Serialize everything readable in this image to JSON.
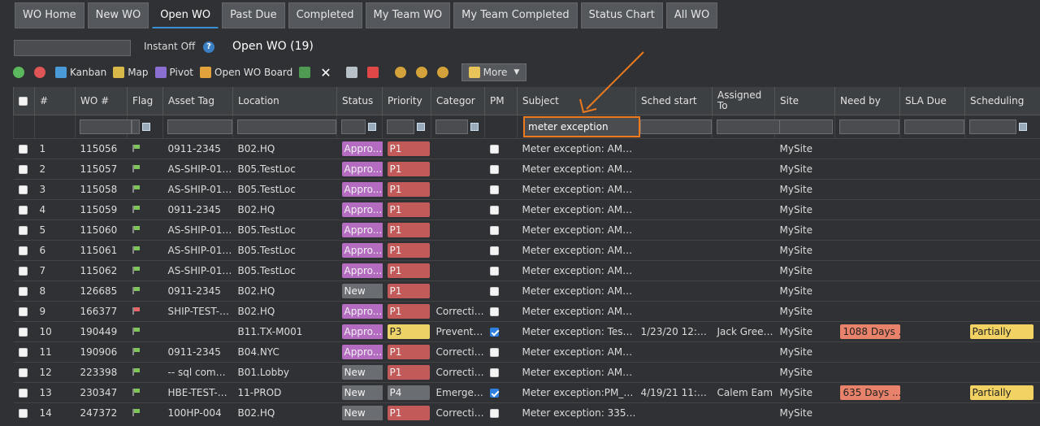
{
  "tabs": [
    {
      "label": "WO Home",
      "active": false
    },
    {
      "label": "New WO",
      "active": false
    },
    {
      "label": "Open WO",
      "active": true
    },
    {
      "label": "Past Due",
      "active": false
    },
    {
      "label": "Completed",
      "active": false
    },
    {
      "label": "My Team WO",
      "active": false
    },
    {
      "label": "My Team Completed",
      "active": false
    },
    {
      "label": "Status Chart",
      "active": false
    },
    {
      "label": "All WO",
      "active": false
    }
  ],
  "header": {
    "instant": "Instant Off",
    "help": "?",
    "title": "Open WO (19)"
  },
  "toolbar": {
    "kanban": "Kanban",
    "map": "Map",
    "pivot": "Pivot",
    "board": "Open WO Board",
    "more": "More"
  },
  "colors": {
    "approved": "#b36cc0",
    "new": "#6a6d71",
    "p1": "#c25a5a",
    "p3": "#ecd166",
    "p4": "#6a6d71",
    "flag_green": "#7fc65a",
    "flag_red": "#e56767",
    "accent": "#3a8fd1",
    "annotation": "#ee7a1e"
  },
  "columns": [
    "#",
    "WO #",
    "Flag",
    "Asset Tag",
    "Location",
    "Status",
    "Priority",
    "Categor",
    "PM",
    "Subject",
    "Sched start",
    "Assigned To",
    "Site",
    "Need by",
    "SLA Due",
    "Scheduling"
  ],
  "filter": {
    "subject": "meter exception"
  },
  "rows": [
    {
      "n": "1",
      "wo": "115056",
      "flag": "green",
      "asset": "0911-2345",
      "loc": "B02.HQ",
      "status": "Appro...",
      "st": "approved",
      "pri": "P1",
      "cat": "",
      "pm": false,
      "subject": "Meter exception: AMP-...",
      "sched": "",
      "assigned": "",
      "site": "MySite",
      "need": "",
      "sla": "",
      "scheduling": ""
    },
    {
      "n": "2",
      "wo": "115057",
      "flag": "green",
      "asset": "AS-SHIP-01_...",
      "loc": "B05.TestLoc",
      "status": "Appro...",
      "st": "approved",
      "pri": "P1",
      "cat": "",
      "pm": false,
      "subject": "Meter exception: AMP-...",
      "sched": "",
      "assigned": "",
      "site": "MySite",
      "need": "",
      "sla": "",
      "scheduling": ""
    },
    {
      "n": "3",
      "wo": "115058",
      "flag": "green",
      "asset": "AS-SHIP-01_...",
      "loc": "B05.TestLoc",
      "status": "Appro...",
      "st": "approved",
      "pri": "P1",
      "cat": "",
      "pm": false,
      "subject": "Meter exception: AMP-...",
      "sched": "",
      "assigned": "",
      "site": "MySite",
      "need": "",
      "sla": "",
      "scheduling": ""
    },
    {
      "n": "4",
      "wo": "115059",
      "flag": "green",
      "asset": "0911-2345",
      "loc": "B02.HQ",
      "status": "Appro...",
      "st": "approved",
      "pri": "P1",
      "cat": "",
      "pm": false,
      "subject": "Meter exception: AMP-...",
      "sched": "",
      "assigned": "",
      "site": "MySite",
      "need": "",
      "sla": "",
      "scheduling": ""
    },
    {
      "n": "5",
      "wo": "115060",
      "flag": "green",
      "asset": "AS-SHIP-01_...",
      "loc": "B05.TestLoc",
      "status": "Appro...",
      "st": "approved",
      "pri": "P1",
      "cat": "",
      "pm": false,
      "subject": "Meter exception: AMP-...",
      "sched": "",
      "assigned": "",
      "site": "MySite",
      "need": "",
      "sla": "",
      "scheduling": ""
    },
    {
      "n": "6",
      "wo": "115061",
      "flag": "green",
      "asset": "AS-SHIP-01_...",
      "loc": "B05.TestLoc",
      "status": "Appro...",
      "st": "approved",
      "pri": "P1",
      "cat": "",
      "pm": false,
      "subject": "Meter exception: AMP-...",
      "sched": "",
      "assigned": "",
      "site": "MySite",
      "need": "",
      "sla": "",
      "scheduling": ""
    },
    {
      "n": "7",
      "wo": "115062",
      "flag": "green",
      "asset": "AS-SHIP-01_...",
      "loc": "B05.TestLoc",
      "status": "Appro...",
      "st": "approved",
      "pri": "P1",
      "cat": "",
      "pm": false,
      "subject": "Meter exception: AMP-...",
      "sched": "",
      "assigned": "",
      "site": "MySite",
      "need": "",
      "sla": "",
      "scheduling": ""
    },
    {
      "n": "8",
      "wo": "126685",
      "flag": "green",
      "asset": "0911-2345",
      "loc": "B02.HQ",
      "status": "New",
      "st": "new",
      "pri": "P1",
      "cat": "",
      "pm": false,
      "subject": "Meter exception: AMP-...",
      "sched": "",
      "assigned": "",
      "site": "MySite",
      "need": "",
      "sla": "",
      "scheduling": ""
    },
    {
      "n": "9",
      "wo": "166377",
      "flag": "red",
      "asset": "SHIP-TEST-0...",
      "loc": "B02.HQ",
      "status": "Appro...",
      "st": "approved",
      "pri": "P1",
      "cat": "Corrective",
      "pm": false,
      "subject": "Meter exception: AMP-...",
      "sched": "",
      "assigned": "",
      "site": "MySite",
      "need": "",
      "sla": "",
      "scheduling": ""
    },
    {
      "n": "10",
      "wo": "190449",
      "flag": "green",
      "asset": "",
      "loc": "B11.TX-M001",
      "status": "Appro...",
      "st": "approved",
      "pri": "P3",
      "cat": "Preventive",
      "pm": true,
      "subject": "Meter exception: Test ...",
      "sched": "1/23/20 12:0...",
      "assigned": "Jack Greener",
      "site": "MySite",
      "need": "1088 Days ...",
      "sla": "",
      "scheduling": "Partially"
    },
    {
      "n": "11",
      "wo": "190906",
      "flag": "green",
      "asset": "0911-2345",
      "loc": "B04.NYC",
      "status": "Appro...",
      "st": "approved",
      "pri": "P1",
      "cat": "Corrective",
      "pm": false,
      "subject": "Meter exception: AMP-...",
      "sched": "",
      "assigned": "",
      "site": "MySite",
      "need": "",
      "sla": "",
      "scheduling": ""
    },
    {
      "n": "12",
      "wo": "223398",
      "flag": "green",
      "asset": "-- sql comm...",
      "loc": "B01.Lobby",
      "status": "New",
      "st": "new",
      "pri": "P1",
      "cat": "Corrective",
      "pm": false,
      "subject": "Meter exception: AMP-...",
      "sched": "",
      "assigned": "",
      "site": "MySite",
      "need": "",
      "sla": "",
      "scheduling": ""
    },
    {
      "n": "13",
      "wo": "230347",
      "flag": "green",
      "asset": "HBE-TEST-003",
      "loc": "11-PROD",
      "status": "New",
      "st": "new",
      "pri": "P4",
      "cat": "Emergency",
      "pm": true,
      "subject": "Meter exception:PM_W...",
      "sched": "4/19/21 11:0...",
      "assigned": "Calem Eam",
      "site": "MySite",
      "need": "635 Days ...",
      "sla": "",
      "scheduling": "Partially"
    },
    {
      "n": "14",
      "wo": "247372",
      "flag": "green",
      "asset": "100HP-004",
      "loc": "B02.HQ",
      "status": "New",
      "st": "new",
      "pri": "P1",
      "cat": "Corrective",
      "pm": false,
      "subject": "Meter exception: 33559",
      "sched": "",
      "assigned": "",
      "site": "MySite",
      "need": "",
      "sla": "",
      "scheduling": ""
    }
  ]
}
